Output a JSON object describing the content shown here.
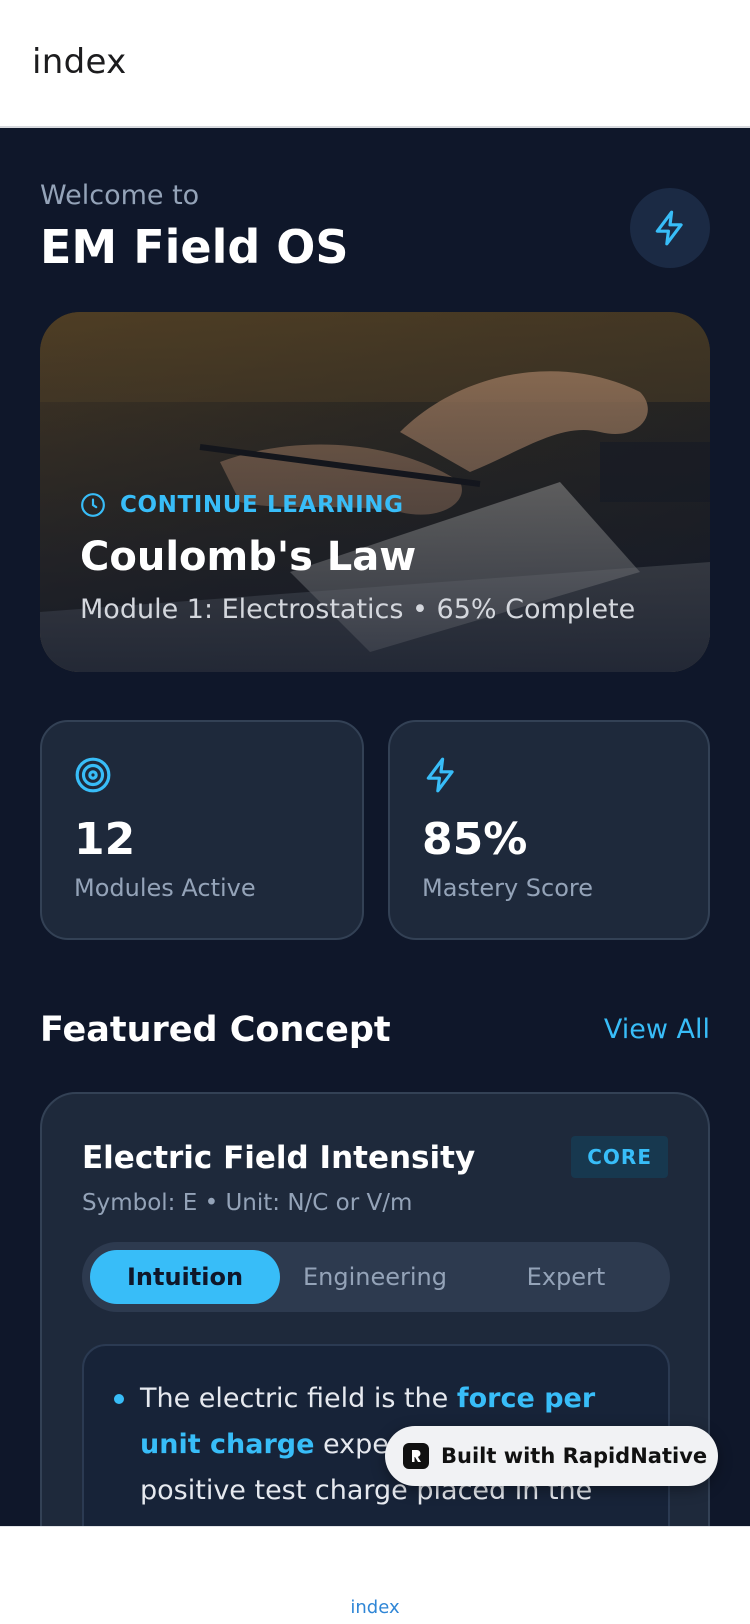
{
  "header": {
    "title": "index"
  },
  "welcome": {
    "eyebrow": "Welcome to",
    "app_name": "EM Field OS",
    "action_icon": "bolt-icon"
  },
  "hero": {
    "eyebrow": "CONTINUE LEARNING",
    "eyebrow_icon": "clock-icon",
    "lesson": "Coulomb's Law",
    "meta": "Module 1: Electrostatics • 65% Complete",
    "progress_percent": 65
  },
  "stats": [
    {
      "icon": "target-icon",
      "value": "12",
      "label": "Modules Active"
    },
    {
      "icon": "bolt-icon",
      "value": "85%",
      "label": "Mastery Score"
    }
  ],
  "featured": {
    "title": "Featured Concept",
    "view_all": "View All",
    "concept": {
      "name": "Electric Field Intensity",
      "badge": "CORE",
      "subtitle": "Symbol: E • Unit: N/C or V/m",
      "tabs": [
        "Intuition",
        "Engineering",
        "Expert"
      ],
      "active_tab": "Intuition",
      "explanation": {
        "lead": "The electric field is the ",
        "highlight": "force per unit charge",
        "rest": " experienced by a positive test charge placed in the"
      }
    }
  },
  "badge_overlay": {
    "label": "Built with RapidNative"
  },
  "bottom_nav": {
    "tab_label": "index"
  },
  "colors": {
    "background": "#0f172a",
    "card": "#1e293b",
    "accent": "#38bdf8"
  }
}
